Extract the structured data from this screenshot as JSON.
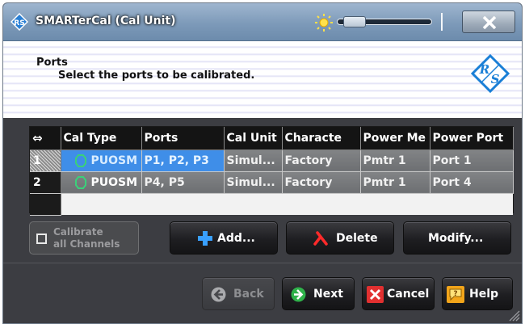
{
  "window": {
    "title": "SMARTerCal (Cal Unit)",
    "accent": "#7d9ab9",
    "brightness": 0.05
  },
  "header": {
    "title": "Ports",
    "subtitle": "Select the ports to be calibrated."
  },
  "table": {
    "columns": [
      "Cal Type",
      "Ports",
      "Cal Unit",
      "Characte",
      "Power Me",
      "Power Port"
    ],
    "rows": [
      {
        "num": "1",
        "cal_type": "PUOSM",
        "ports": "P1, P2, P3",
        "cal_unit": "Simul...",
        "characterization": "Factory",
        "power_meter": "Pmtr 1",
        "power_port": "Port 1",
        "selected": true
      },
      {
        "num": "2",
        "cal_type": "PUOSM",
        "ports": "P4, P5",
        "cal_unit": "Simul...",
        "characterization": "Factory",
        "power_meter": "Pmtr 1",
        "power_port": "Port 4",
        "selected": false
      }
    ]
  },
  "actions": {
    "calibrate_all_line1": "Calibrate",
    "calibrate_all_line2": "all Channels",
    "add": "Add...",
    "delete": "Delete",
    "modify": "Modify..."
  },
  "nav": {
    "back": "Back",
    "next": "Next",
    "cancel": "Cancel",
    "help": "Help"
  },
  "icons": {
    "app": "rs-diamond-icon",
    "brightness": "sun-icon",
    "close": "close-x-icon",
    "logo": "rohde-schwarz-logo",
    "add": "plus-icon",
    "delete": "red-x-icon",
    "back": "left-arrow-icon",
    "next": "right-arrow-icon",
    "cancel": "cancel-x-icon",
    "help": "help-speech-bubble-icon"
  }
}
